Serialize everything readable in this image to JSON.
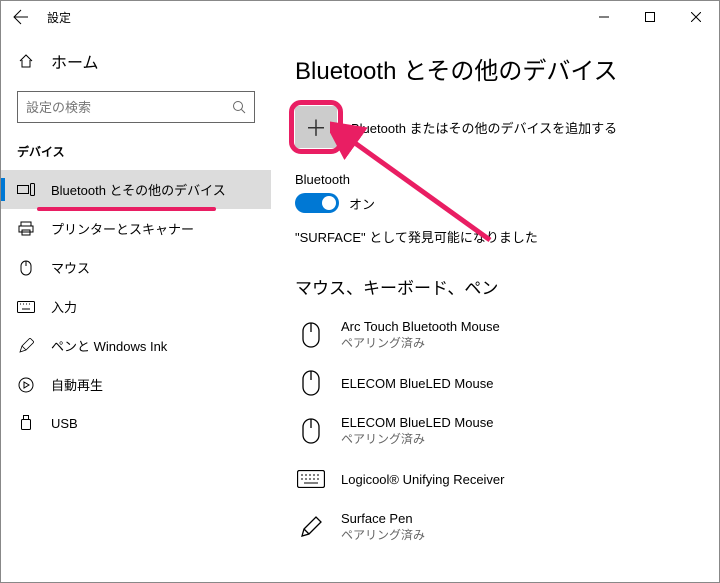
{
  "window": {
    "title": "設定"
  },
  "sidebar": {
    "home": "ホーム",
    "search_placeholder": "設定の検索",
    "section": "デバイス",
    "items": [
      {
        "label": "Bluetooth とその他のデバイス",
        "active": true
      },
      {
        "label": "プリンターとスキャナー"
      },
      {
        "label": "マウス"
      },
      {
        "label": "入力"
      },
      {
        "label": "ペンと Windows Ink"
      },
      {
        "label": "自動再生"
      },
      {
        "label": "USB"
      }
    ]
  },
  "main": {
    "title": "Bluetooth とその他のデバイス",
    "add_label": "Bluetooth またはその他のデバイスを追加する",
    "bt_label": "Bluetooth",
    "toggle_state": "オン",
    "status": "\"SURFACE\" として発見可能になりました",
    "section_title": "マウス、キーボード、ペン",
    "devices": [
      {
        "name": "Arc Touch Bluetooth Mouse",
        "status": "ペアリング済み",
        "icon": "mouse"
      },
      {
        "name": "ELECOM BlueLED Mouse",
        "status": "",
        "icon": "mouse"
      },
      {
        "name": "ELECOM BlueLED Mouse",
        "status": "ペアリング済み",
        "icon": "mouse"
      },
      {
        "name": "Logicool® Unifying Receiver",
        "status": "",
        "icon": "keyboard"
      },
      {
        "name": "Surface Pen",
        "status": "ペアリング済み",
        "icon": "pen"
      }
    ]
  }
}
